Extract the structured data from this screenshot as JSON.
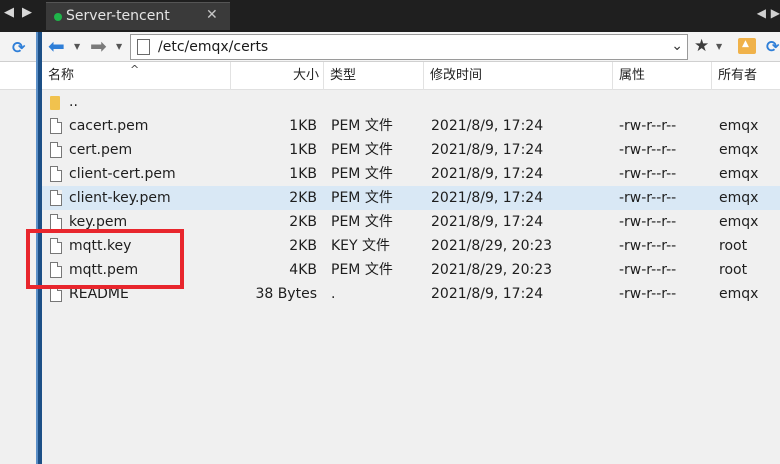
{
  "tab": {
    "title": "Server-tencent",
    "close": "✕",
    "status_color": "#1fb54a"
  },
  "toolbar": {
    "path": "/etc/emqx/certs",
    "back_icon": "arrow-left-icon",
    "forward_icon": "arrow-right-icon",
    "bookmark_icon": "star-icon",
    "parent_icon": "up-folder-icon",
    "refresh_icon": "refresh-icon"
  },
  "columns": {
    "name": "名称",
    "size": "大小",
    "type": "类型",
    "modified": "修改时间",
    "attributes": "属性",
    "owner": "所有者"
  },
  "files": [
    {
      "name": "..",
      "size": "",
      "type": "",
      "modified": "",
      "attributes": "",
      "owner": "",
      "kind": "folder"
    },
    {
      "name": "cacert.pem",
      "size": "1KB",
      "type": "PEM 文件",
      "modified": "2021/8/9, 17:24",
      "attributes": "-rw-r--r--",
      "owner": "emqx",
      "kind": "file"
    },
    {
      "name": "cert.pem",
      "size": "1KB",
      "type": "PEM 文件",
      "modified": "2021/8/9, 17:24",
      "attributes": "-rw-r--r--",
      "owner": "emqx",
      "kind": "file"
    },
    {
      "name": "client-cert.pem",
      "size": "1KB",
      "type": "PEM 文件",
      "modified": "2021/8/9, 17:24",
      "attributes": "-rw-r--r--",
      "owner": "emqx",
      "kind": "file"
    },
    {
      "name": "client-key.pem",
      "size": "2KB",
      "type": "PEM 文件",
      "modified": "2021/8/9, 17:24",
      "attributes": "-rw-r--r--",
      "owner": "emqx",
      "kind": "file",
      "selected": true
    },
    {
      "name": "key.pem",
      "size": "2KB",
      "type": "PEM 文件",
      "modified": "2021/8/9, 17:24",
      "attributes": "-rw-r--r--",
      "owner": "emqx",
      "kind": "file"
    },
    {
      "name": "mqtt.key",
      "size": "2KB",
      "type": "KEY 文件",
      "modified": "2021/8/29, 20:23",
      "attributes": "-rw-r--r--",
      "owner": "root",
      "kind": "file"
    },
    {
      "name": "mqtt.pem",
      "size": "4KB",
      "type": "PEM 文件",
      "modified": "2021/8/29, 20:23",
      "attributes": "-rw-r--r--",
      "owner": "root",
      "kind": "file"
    },
    {
      "name": "README",
      "size": "38 Bytes",
      "type": ".",
      "modified": "2021/8/9, 17:24",
      "attributes": "-rw-r--r--",
      "owner": "emqx",
      "kind": "file"
    }
  ],
  "colors": {
    "selection": "#d9e8f5",
    "highlight_box": "#e8262d",
    "accent": "#2f7fd8"
  }
}
